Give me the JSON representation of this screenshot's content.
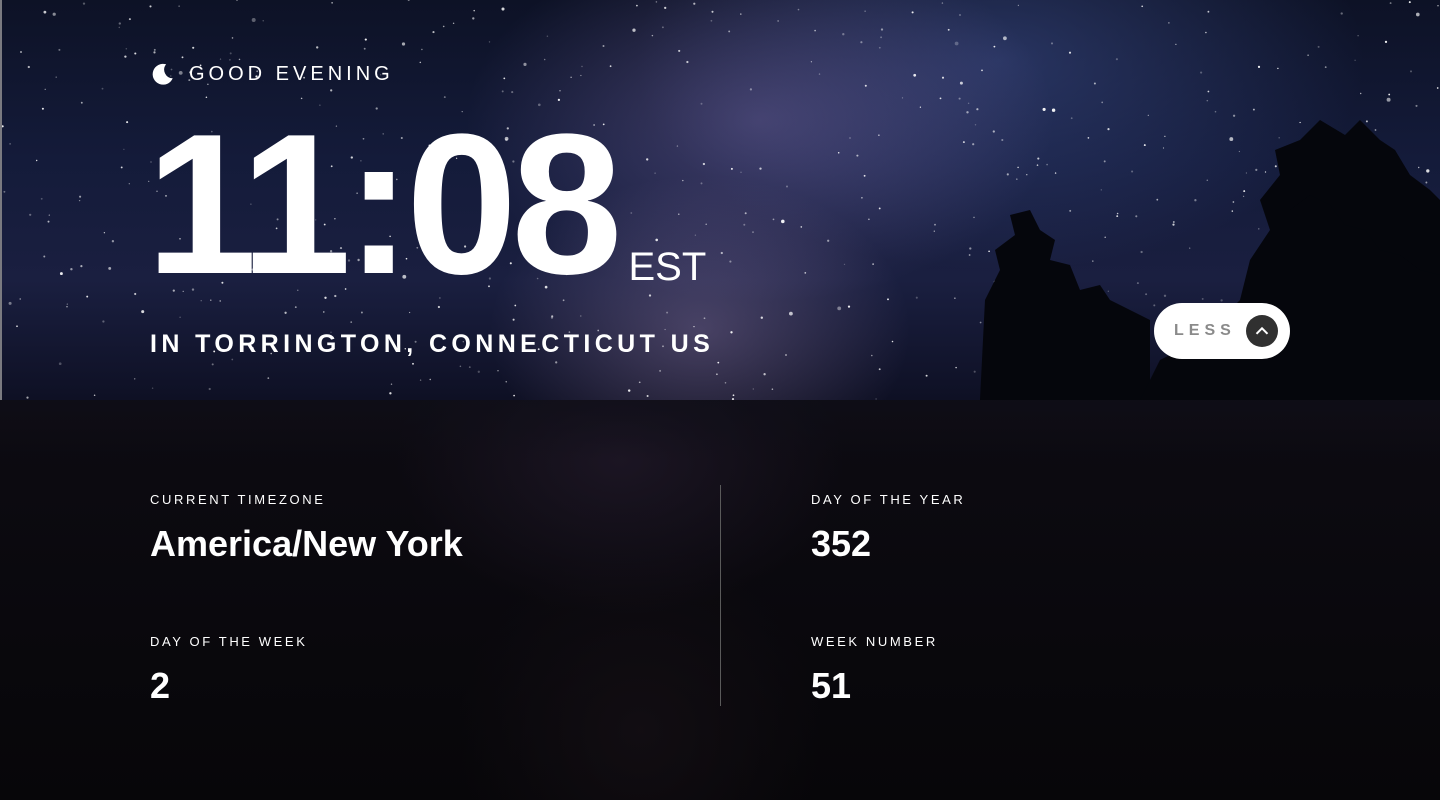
{
  "greeting": {
    "icon": "moon-icon",
    "text": "GOOD EVENING"
  },
  "clock": {
    "time": "11:08",
    "timezone_abbr": "EST"
  },
  "location": "IN TORRINGTON, CONNECTICUT US",
  "toggle": {
    "label": "LESS",
    "icon": "chevron-up-icon"
  },
  "details": {
    "timezone": {
      "label": "CURRENT TIMEZONE",
      "value": "America/New York"
    },
    "day_of_week": {
      "label": "DAY OF THE WEEK",
      "value": "2"
    },
    "day_of_year": {
      "label": "DAY OF THE YEAR",
      "value": "352"
    },
    "week_number": {
      "label": "WEEK NUMBER",
      "value": "51"
    }
  },
  "colors": {
    "panel_background": "#070609",
    "button_background": "#ffffff",
    "button_label": "#8a8a8a",
    "button_icon_background": "#303030"
  }
}
